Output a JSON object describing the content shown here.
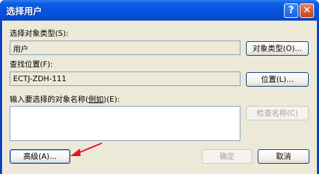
{
  "window": {
    "title": "选择用户"
  },
  "titlebar": {
    "help_glyph": "?",
    "close_glyph": "✕"
  },
  "object_type": {
    "label": "选择对象类型",
    "hotkey_label": "(S):",
    "value": "用户",
    "button_label": "对象类型",
    "button_hotkey": "(O)..."
  },
  "location": {
    "label": "查找位置",
    "hotkey_label": "(F):",
    "value": "ECTJ-ZDH-111",
    "button_label": "位置",
    "button_hotkey": "(L)..."
  },
  "names": {
    "label": "输入要选择的对象名称",
    "example_open": "(",
    "example_link": "例如",
    "example_close": ")",
    "hotkey_label": "(E):",
    "value": "",
    "check_button_label": "检查名称",
    "check_button_hotkey": "(C)"
  },
  "footer": {
    "advanced_label": "高级",
    "advanced_hotkey": "(A)...",
    "ok_label": "确定",
    "cancel_label": "取消"
  },
  "annotation": {
    "arrow_color": "#e8141a"
  }
}
